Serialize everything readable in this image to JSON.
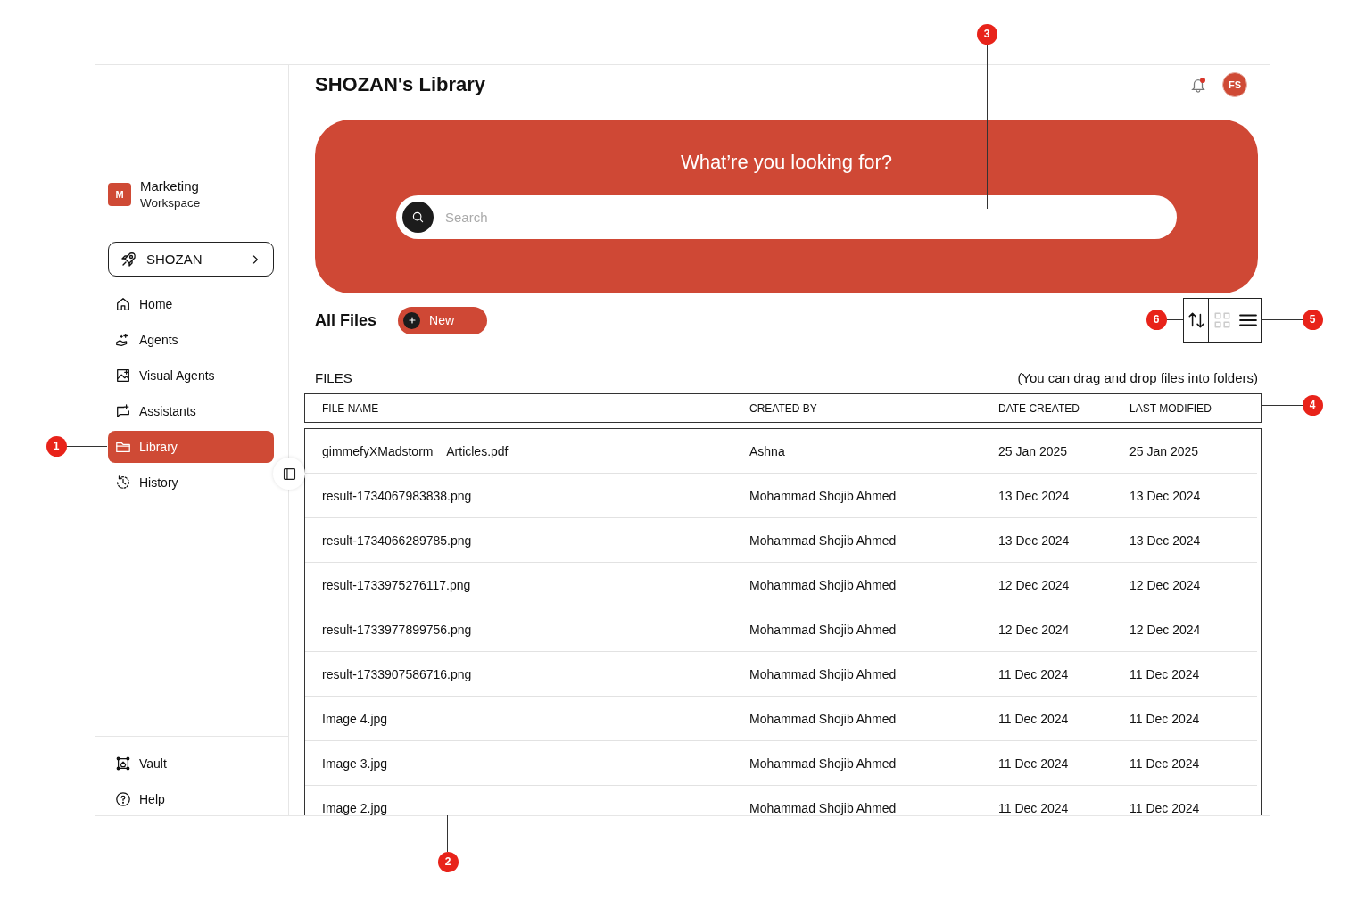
{
  "sidebar": {
    "workspace": {
      "initial": "M",
      "name": "Marketing",
      "subtitle": "Workspace"
    },
    "org_button": {
      "label": "SHOZAN"
    },
    "nav": [
      {
        "label": "Home",
        "selected": false
      },
      {
        "label": "Agents",
        "selected": false
      },
      {
        "label": "Visual Agents",
        "selected": false
      },
      {
        "label": "Assistants",
        "selected": false
      },
      {
        "label": "Library",
        "selected": true
      },
      {
        "label": "History",
        "selected": false
      }
    ],
    "footer": [
      {
        "label": "Vault"
      },
      {
        "label": "Help"
      }
    ]
  },
  "header": {
    "title": "SHOZAN's Library",
    "unread_notifications": true,
    "avatar": "FS"
  },
  "hero": {
    "heading": "What’re you looking for?",
    "search": {
      "placeholder": "Search"
    }
  },
  "toolbar": {
    "title": "All Files",
    "new_button": "New",
    "views": [
      {
        "kind": "grid",
        "selected": false
      },
      {
        "kind": "list",
        "selected": true
      }
    ]
  },
  "files": {
    "label": "FILES",
    "hint": "(You can drag and drop files into folders)",
    "columns": [
      "FILE NAME",
      "CREATED BY",
      "DATE CREATED",
      "LAST MODIFIED"
    ],
    "rows": [
      [
        "gimmefyXMadstorm _ Articles.pdf",
        "Ashna",
        "25 Jan 2025",
        "25 Jan 2025"
      ],
      [
        "result-1734067983838.png",
        "Mohammad Shojib Ahmed",
        "13 Dec 2024",
        "13 Dec 2024"
      ],
      [
        "result-1734066289785.png",
        "Mohammad Shojib Ahmed",
        "13 Dec 2024",
        "13 Dec 2024"
      ],
      [
        "result-1733975276117.png",
        "Mohammad Shojib Ahmed",
        "12 Dec 2024",
        "12 Dec 2024"
      ],
      [
        "result-1733977899756.png",
        "Mohammad Shojib Ahmed",
        "12 Dec 2024",
        "12 Dec 2024"
      ],
      [
        "result-1733907586716.png",
        "Mohammad Shojib Ahmed",
        "11 Dec 2024",
        "11 Dec 2024"
      ],
      [
        "Image 4.jpg",
        "Mohammad Shojib Ahmed",
        "11 Dec 2024",
        "11 Dec 2024"
      ],
      [
        "Image 3.jpg",
        "Mohammad Shojib Ahmed",
        "11 Dec 2024",
        "11 Dec 2024"
      ],
      [
        "Image 2.jpg",
        "Mohammad Shojib Ahmed",
        "11 Dec 2024",
        "11 Dec 2024"
      ]
    ]
  },
  "callouts": [
    {
      "label": "1"
    },
    {
      "label": "2"
    },
    {
      "label": "3"
    },
    {
      "label": "4"
    },
    {
      "label": "5"
    },
    {
      "label": "6"
    }
  ]
}
